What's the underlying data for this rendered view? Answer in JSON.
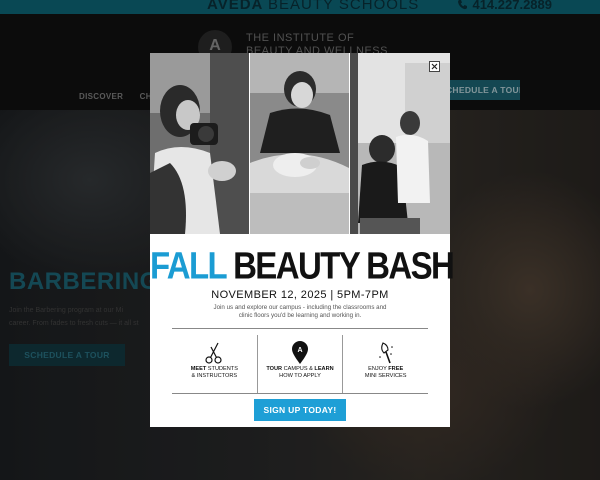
{
  "topbar": {
    "brand": "AVEDA",
    "brand_sub": "BEAUTY SCHOOLS",
    "phone": "414.227.2889",
    "phone_icon": "phone-icon"
  },
  "header": {
    "logo_line1": "THE INSTITUTE OF",
    "logo_line2": "BEAUTY AND WELLNESS",
    "nav": [
      "DISCOVER",
      "CHICA"
    ],
    "tour_button": "SCHEDULE A TOUR"
  },
  "hero": {
    "title": "BARBERING",
    "copy_line1": "Join the Barbering program at our Mi",
    "copy_line2": "career. From fades to fresh cuts — it all st",
    "button": "SCHEDULE A TOUR"
  },
  "modal": {
    "title_a": "FALL",
    "title_b": "BEAUTY BASH",
    "date": "NOVEMBER 12, 2025 | 5PM-7PM",
    "desc_line1": "Join us and explore our campus - including the classrooms and",
    "desc_line2": "clinic floors you'd be learning and working in.",
    "features": [
      {
        "icon": "scissors-icon",
        "pre": "",
        "bold": "MEET",
        "post": " STUDENTS",
        "line2": "& INSTRUCTORS"
      },
      {
        "icon": "location-pin-icon",
        "pre": "",
        "bold": "TOUR",
        "post": " CAMPUS & ",
        "bold2": "LEARN",
        "line2": "HOW TO APPLY"
      },
      {
        "icon": "makeup-brush-icon",
        "pre": "ENJOY ",
        "bold": "FREE",
        "post": "",
        "line2": "MINI SERVICES"
      }
    ],
    "cta": "SIGN UP TODAY!",
    "close_icon": "close-icon",
    "accent": "#1b9cd3"
  }
}
